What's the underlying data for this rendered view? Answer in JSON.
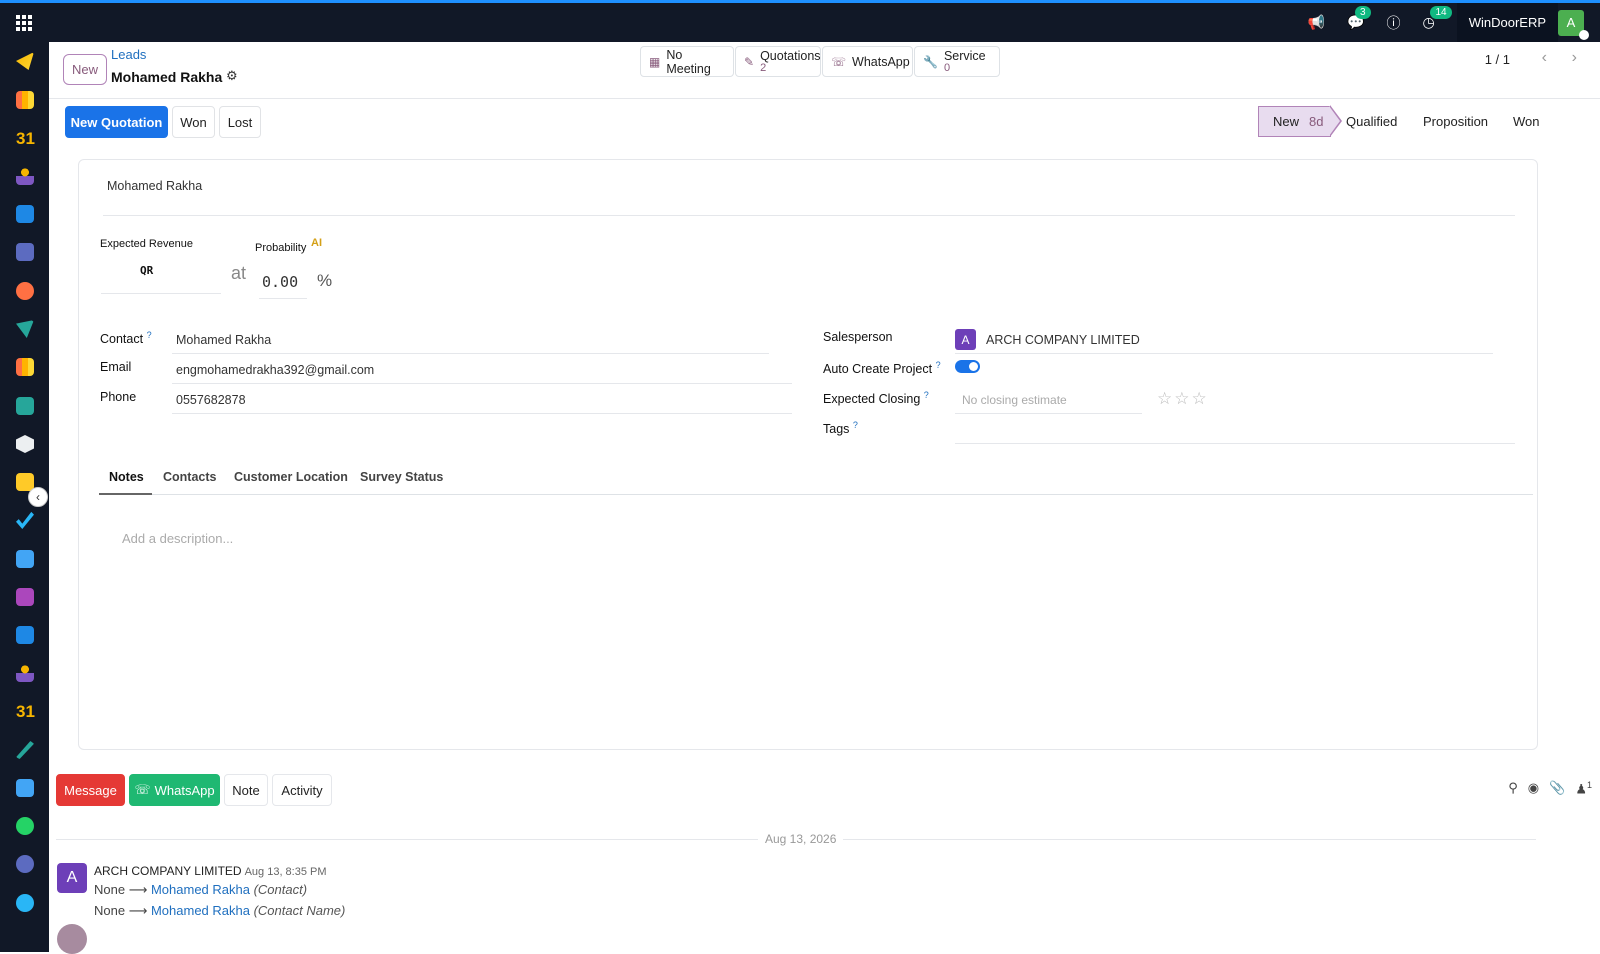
{
  "topbar": {
    "company": "WinDoorERP",
    "user_initial": "A",
    "messages_badge": "3",
    "activity_badge": "14"
  },
  "breadcrumb": {
    "new_label": "New",
    "parent": "Leads",
    "title": "Mohamed Rakha"
  },
  "smart_buttons": [
    {
      "label": "No Meeting",
      "count": ""
    },
    {
      "label": "Quotations",
      "count": "2"
    },
    {
      "label": "WhatsApp",
      "count": ""
    },
    {
      "label": "Service",
      "count": "0"
    }
  ],
  "pager": {
    "text": "1 / 1"
  },
  "actions": {
    "new_quotation": "New Quotation",
    "won": "Won",
    "lost": "Lost"
  },
  "stages": {
    "active": "New",
    "active_duration": "8d",
    "qualified": "Qualified",
    "proposition": "Proposition",
    "won": "Won"
  },
  "form": {
    "lead_name": "Mohamed Rakha",
    "expected_revenue_label": "Expected Revenue",
    "currency": "QR",
    "at_label": "at",
    "probability_label": "Probability",
    "probability_value": "0.00",
    "percent": "%",
    "ai_label": "AI",
    "contact_label": "Contact",
    "contact_value": "Mohamed Rakha",
    "email_label": "Email",
    "email_value": "engmohamedrakha392@gmail.com",
    "phone_label": "Phone",
    "phone_value": "0557682878",
    "salesperson_label": "Salesperson",
    "salesperson_initial": "A",
    "salesperson_value": "ARCH COMPANY LIMITED",
    "auto_create_label": "Auto Create Project",
    "expected_closing_label": "Expected Closing",
    "expected_closing_placeholder": "No closing estimate",
    "tags_label": "Tags",
    "help_mark": "?"
  },
  "tabs": [
    "Notes",
    "Contacts",
    "Customer Location",
    "Survey Status"
  ],
  "notes": {
    "placeholder": "Add a description..."
  },
  "chatter": {
    "message": "Message",
    "whatsapp": "WhatsApp",
    "note": "Note",
    "activity": "Activity",
    "followers_count": "1",
    "date_separator": "Aug 13, 2026",
    "entries": [
      {
        "author_initial": "A",
        "author": "ARCH COMPANY LIMITED",
        "date": "Aug 13, 8:35 PM",
        "changes": [
          {
            "old": "None",
            "new": "Mohamed Rakha",
            "field": "(Contact)"
          },
          {
            "old": "None",
            "new": "Mohamed Rakha",
            "field": "(Contact Name)"
          }
        ]
      }
    ]
  },
  "colors": {
    "primary": "#1a73e8",
    "brand": "#875a7b",
    "danger": "#e53935",
    "whatsapp": "#1fb872",
    "topbar": "#111827"
  }
}
